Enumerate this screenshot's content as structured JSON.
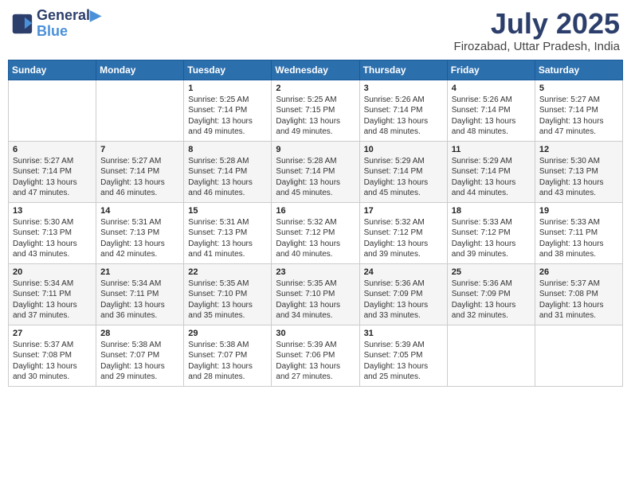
{
  "header": {
    "logo_line1": "General",
    "logo_line2": "Blue",
    "month": "July 2025",
    "location": "Firozabad, Uttar Pradesh, India"
  },
  "weekdays": [
    "Sunday",
    "Monday",
    "Tuesday",
    "Wednesday",
    "Thursday",
    "Friday",
    "Saturday"
  ],
  "weeks": [
    [
      {
        "day": "",
        "content": ""
      },
      {
        "day": "",
        "content": ""
      },
      {
        "day": "1",
        "content": "Sunrise: 5:25 AM\nSunset: 7:14 PM\nDaylight: 13 hours and 49 minutes."
      },
      {
        "day": "2",
        "content": "Sunrise: 5:25 AM\nSunset: 7:15 PM\nDaylight: 13 hours and 49 minutes."
      },
      {
        "day": "3",
        "content": "Sunrise: 5:26 AM\nSunset: 7:14 PM\nDaylight: 13 hours and 48 minutes."
      },
      {
        "day": "4",
        "content": "Sunrise: 5:26 AM\nSunset: 7:14 PM\nDaylight: 13 hours and 48 minutes."
      },
      {
        "day": "5",
        "content": "Sunrise: 5:27 AM\nSunset: 7:14 PM\nDaylight: 13 hours and 47 minutes."
      }
    ],
    [
      {
        "day": "6",
        "content": "Sunrise: 5:27 AM\nSunset: 7:14 PM\nDaylight: 13 hours and 47 minutes."
      },
      {
        "day": "7",
        "content": "Sunrise: 5:27 AM\nSunset: 7:14 PM\nDaylight: 13 hours and 46 minutes."
      },
      {
        "day": "8",
        "content": "Sunrise: 5:28 AM\nSunset: 7:14 PM\nDaylight: 13 hours and 46 minutes."
      },
      {
        "day": "9",
        "content": "Sunrise: 5:28 AM\nSunset: 7:14 PM\nDaylight: 13 hours and 45 minutes."
      },
      {
        "day": "10",
        "content": "Sunrise: 5:29 AM\nSunset: 7:14 PM\nDaylight: 13 hours and 45 minutes."
      },
      {
        "day": "11",
        "content": "Sunrise: 5:29 AM\nSunset: 7:14 PM\nDaylight: 13 hours and 44 minutes."
      },
      {
        "day": "12",
        "content": "Sunrise: 5:30 AM\nSunset: 7:13 PM\nDaylight: 13 hours and 43 minutes."
      }
    ],
    [
      {
        "day": "13",
        "content": "Sunrise: 5:30 AM\nSunset: 7:13 PM\nDaylight: 13 hours and 43 minutes."
      },
      {
        "day": "14",
        "content": "Sunrise: 5:31 AM\nSunset: 7:13 PM\nDaylight: 13 hours and 42 minutes."
      },
      {
        "day": "15",
        "content": "Sunrise: 5:31 AM\nSunset: 7:13 PM\nDaylight: 13 hours and 41 minutes."
      },
      {
        "day": "16",
        "content": "Sunrise: 5:32 AM\nSunset: 7:12 PM\nDaylight: 13 hours and 40 minutes."
      },
      {
        "day": "17",
        "content": "Sunrise: 5:32 AM\nSunset: 7:12 PM\nDaylight: 13 hours and 39 minutes."
      },
      {
        "day": "18",
        "content": "Sunrise: 5:33 AM\nSunset: 7:12 PM\nDaylight: 13 hours and 39 minutes."
      },
      {
        "day": "19",
        "content": "Sunrise: 5:33 AM\nSunset: 7:11 PM\nDaylight: 13 hours and 38 minutes."
      }
    ],
    [
      {
        "day": "20",
        "content": "Sunrise: 5:34 AM\nSunset: 7:11 PM\nDaylight: 13 hours and 37 minutes."
      },
      {
        "day": "21",
        "content": "Sunrise: 5:34 AM\nSunset: 7:11 PM\nDaylight: 13 hours and 36 minutes."
      },
      {
        "day": "22",
        "content": "Sunrise: 5:35 AM\nSunset: 7:10 PM\nDaylight: 13 hours and 35 minutes."
      },
      {
        "day": "23",
        "content": "Sunrise: 5:35 AM\nSunset: 7:10 PM\nDaylight: 13 hours and 34 minutes."
      },
      {
        "day": "24",
        "content": "Sunrise: 5:36 AM\nSunset: 7:09 PM\nDaylight: 13 hours and 33 minutes."
      },
      {
        "day": "25",
        "content": "Sunrise: 5:36 AM\nSunset: 7:09 PM\nDaylight: 13 hours and 32 minutes."
      },
      {
        "day": "26",
        "content": "Sunrise: 5:37 AM\nSunset: 7:08 PM\nDaylight: 13 hours and 31 minutes."
      }
    ],
    [
      {
        "day": "27",
        "content": "Sunrise: 5:37 AM\nSunset: 7:08 PM\nDaylight: 13 hours and 30 minutes."
      },
      {
        "day": "28",
        "content": "Sunrise: 5:38 AM\nSunset: 7:07 PM\nDaylight: 13 hours and 29 minutes."
      },
      {
        "day": "29",
        "content": "Sunrise: 5:38 AM\nSunset: 7:07 PM\nDaylight: 13 hours and 28 minutes."
      },
      {
        "day": "30",
        "content": "Sunrise: 5:39 AM\nSunset: 7:06 PM\nDaylight: 13 hours and 27 minutes."
      },
      {
        "day": "31",
        "content": "Sunrise: 5:39 AM\nSunset: 7:05 PM\nDaylight: 13 hours and 25 minutes."
      },
      {
        "day": "",
        "content": ""
      },
      {
        "day": "",
        "content": ""
      }
    ]
  ]
}
